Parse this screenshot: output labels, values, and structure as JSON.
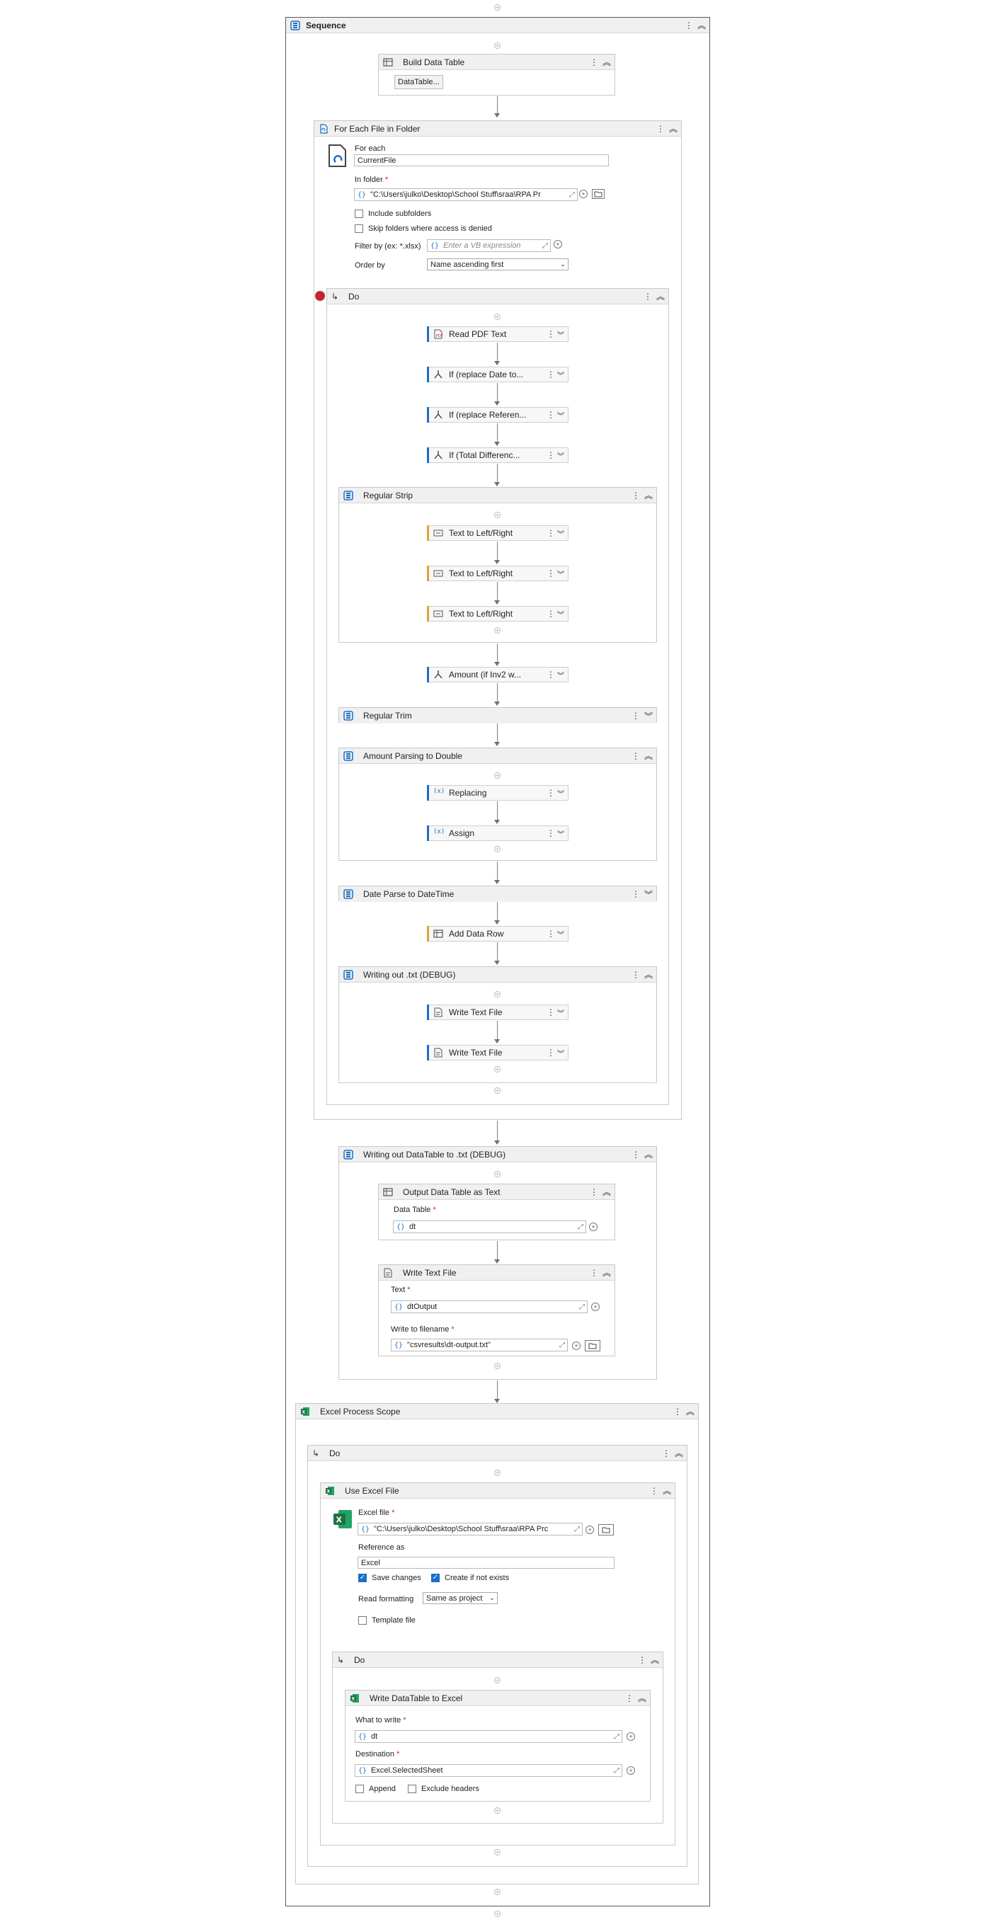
{
  "sequence": {
    "title": "Sequence"
  },
  "build_data_table": {
    "title": "Build Data Table",
    "button": "DataTable..."
  },
  "for_each_folder": {
    "title": "For Each File in Folder",
    "for_each_label": "For each",
    "for_each_value": "CurrentFile",
    "in_folder_label": "In folder",
    "in_folder_value": "\"C:\\Users\\julko\\Desktop\\School Stuff\\sraa\\RPA Pr",
    "include_subfolders": "Include subfolders",
    "skip_folders": "Skip folders where access is denied",
    "filter_label": "Filter by (ex: *.xlsx)",
    "filter_placeholder": "Enter a VB expression",
    "order_label": "Order by",
    "order_value": "Name ascending first"
  },
  "do_body": {
    "title": "Do",
    "read_pdf": "Read PDF Text",
    "if_date": "If (replace Date to...",
    "if_ref": "If (replace Referen...",
    "if_total": "If (Total Differenc...",
    "regular_strip": "Regular Strip",
    "text_lr": "Text to Left/Right",
    "amount_if": "Amount (if Inv2 w...",
    "regular_trim": "Regular Trim",
    "amount_parsing": "Amount Parsing to Double",
    "replacing": "Replacing",
    "assign": "Assign",
    "date_parse": "Date Parse to DateTime",
    "add_data_row": "Add Data Row",
    "writing_txt": "Writing out .txt (DEBUG)",
    "write_text_file": "Write Text File"
  },
  "writing_dt": {
    "title": "Writing out DataTable to .txt (DEBUG)",
    "output_dt_title": "Output Data Table as Text",
    "data_table_label": "Data Table",
    "data_table_value": "dt",
    "write_text_title": "Write Text File",
    "text_label": "Text",
    "text_value": "dtOutput",
    "filename_label": "Write to filename",
    "filename_value": "\"csvresults\\dt-output.txt\""
  },
  "excel_scope": {
    "title": "Excel Process Scope",
    "do": "Do",
    "use_excel_title": "Use Excel File",
    "excel_file_label": "Excel file",
    "excel_file_value": "\"C:\\Users\\julko\\Desktop\\School Stuff\\sraa\\RPA Prc",
    "reference_label": "Reference as",
    "reference_value": "Excel",
    "save_changes": "Save changes",
    "create_if_not_exists": "Create if not exists",
    "read_formatting_label": "Read formatting",
    "read_formatting_value": "Same as project",
    "template_file": "Template file",
    "inner_do": "Do",
    "write_dt_title": "Write DataTable to Excel",
    "what_label": "What to write",
    "what_value": "dt",
    "dest_label": "Destination",
    "dest_value": "Excel.SelectedSheet",
    "append": "Append",
    "exclude_headers": "Exclude headers"
  },
  "colors": {
    "accent_blue": "#1a6fc7",
    "accent_orange": "#e3a13a",
    "excel_green": "#1e7145",
    "breakpoint_red": "#c4262e"
  },
  "icons": [
    "sequence-icon",
    "datatable-icon",
    "foreach-icon",
    "file-icon",
    "if-icon",
    "text-split-icon",
    "assign-icon",
    "write-file-icon",
    "excel-icon",
    "kebab-icon",
    "collapse-icon",
    "expand-icon",
    "add-icon",
    "folder-icon"
  ]
}
